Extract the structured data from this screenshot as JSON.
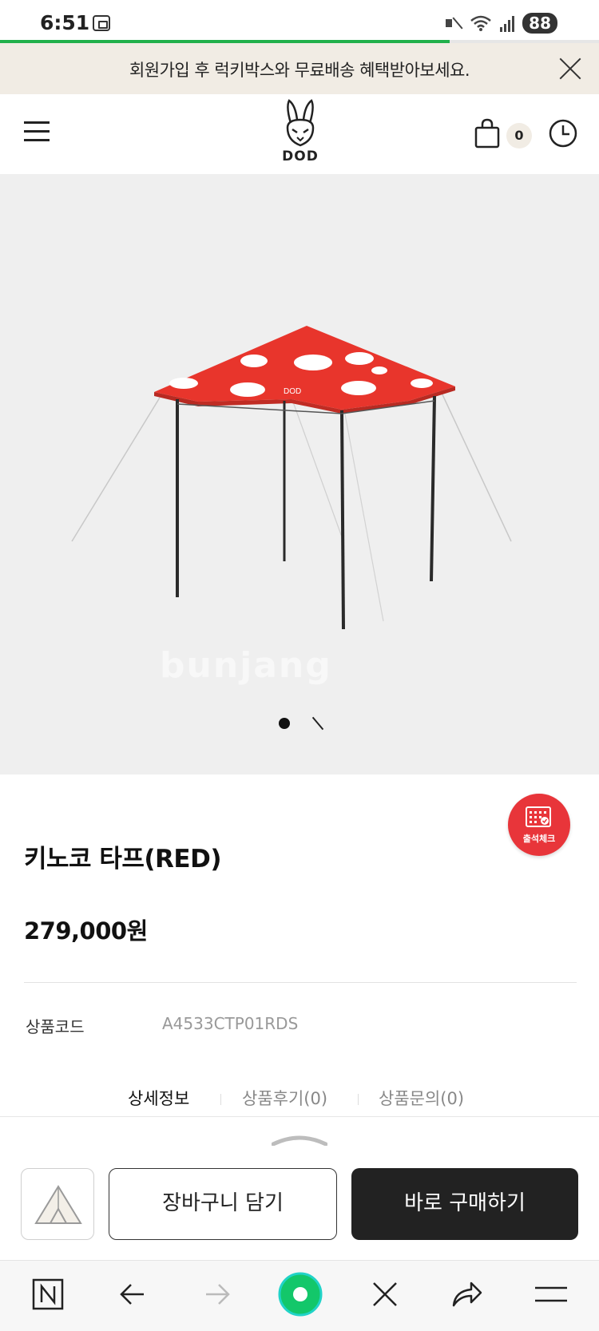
{
  "status_bar": {
    "time": "6:51",
    "battery": "88",
    "page_load_progress": 0.75
  },
  "promo_banner": {
    "text": "회원가입 후 럭키박스와 무료배송 혜택받아보세요."
  },
  "header": {
    "logo_text": "DOD",
    "cart_count": "0"
  },
  "gallery": {
    "watermark": "bunjang",
    "slide_count": 2,
    "active_slide": 1
  },
  "attendance": {
    "label": "출석체크"
  },
  "product": {
    "title": "키노코 타프(RED)",
    "price": "279,000원",
    "code_label": "상품코드",
    "code_value": "A4533CTP01RDS"
  },
  "tabs": [
    {
      "label": "상세정보"
    },
    {
      "label": "상품후기(0)"
    },
    {
      "label": "상품문의(0)"
    }
  ],
  "actions": {
    "cart_label": "장바구니 담기",
    "buy_label": "바로 구매하기"
  },
  "colors": {
    "brand_beige": "#f1ece4",
    "tarp_red": "#e8352c",
    "progress_green": "#21b04b",
    "buy_button": "#222222",
    "attendance_red": "#e8353a"
  },
  "browser_nav": {
    "icons": [
      "naver-n-icon",
      "back-arrow-icon",
      "forward-arrow-icon",
      "green-circle-icon",
      "close-icon",
      "share-icon",
      "menu-icon"
    ]
  }
}
